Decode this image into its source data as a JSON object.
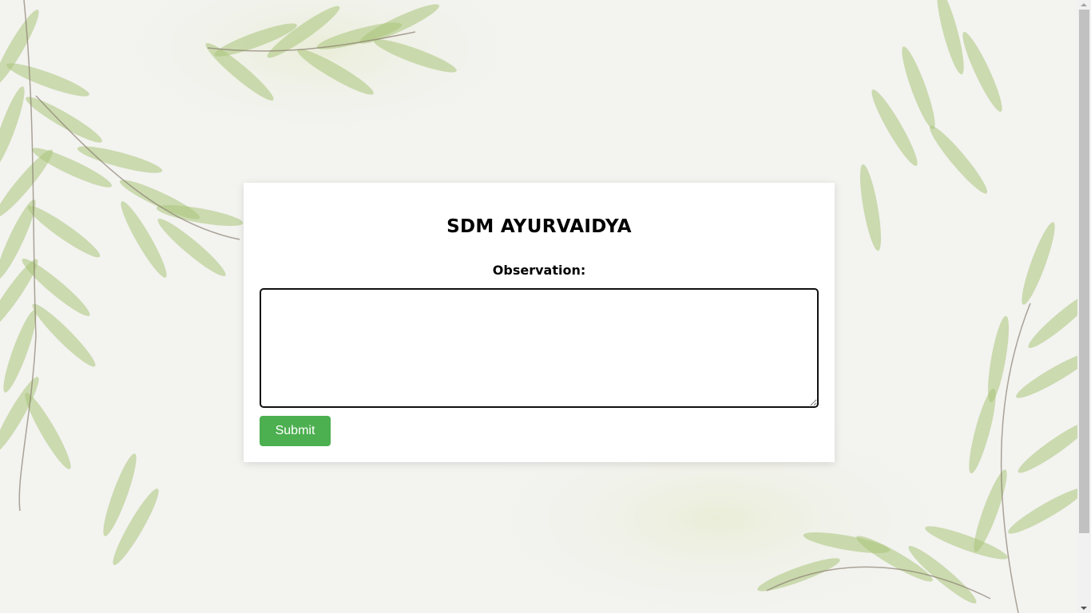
{
  "form": {
    "title": "SDM AYURVAIDYA",
    "observation_label": "Observation:",
    "observation_value": "",
    "submit_label": "Submit"
  },
  "colors": {
    "accent": "#4caf50",
    "leaf": "#9fbf6a"
  }
}
